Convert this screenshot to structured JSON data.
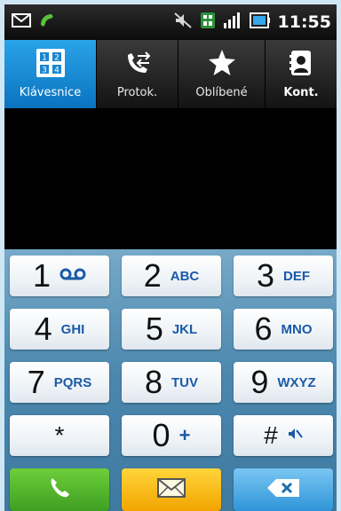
{
  "status_bar": {
    "time": "11:55",
    "icons": [
      "envelope-icon",
      "missed-call-icon",
      "mute-icon",
      "3g-icon",
      "signal-icon",
      "battery-icon"
    ]
  },
  "tabs": [
    {
      "label": "Klávesnice",
      "icon": "keypad-icon",
      "active": true
    },
    {
      "label": "Protok.",
      "icon": "call-log-icon",
      "active": false
    },
    {
      "label": "Oblíbené",
      "icon": "star-icon",
      "active": false
    },
    {
      "label": "Kont.",
      "icon": "contacts-icon",
      "active": false
    }
  ],
  "keys": [
    {
      "digit": "1",
      "letters": "oo",
      "icon": "voicemail-icon"
    },
    {
      "digit": "2",
      "letters": "ABC"
    },
    {
      "digit": "3",
      "letters": "DEF"
    },
    {
      "digit": "4",
      "letters": "GHI"
    },
    {
      "digit": "5",
      "letters": "JKL"
    },
    {
      "digit": "6",
      "letters": "MNO"
    },
    {
      "digit": "7",
      "letters": "PQRS"
    },
    {
      "digit": "8",
      "letters": "TUV"
    },
    {
      "digit": "9",
      "letters": "WXYZ"
    },
    {
      "digit": "*",
      "letters": ""
    },
    {
      "digit": "0",
      "letters": "+"
    },
    {
      "digit": "#",
      "letters": "",
      "icon": "mute-icon"
    }
  ],
  "actions": {
    "call": {
      "icon": "phone-icon"
    },
    "message": {
      "icon": "envelope-icon"
    },
    "delete": {
      "icon": "backspace-icon"
    }
  },
  "colors": {
    "tab_active": "#1e8fd8",
    "keypad_bg": "#4a86ad",
    "letters": "#1a5aa8",
    "call": "#4fb52c",
    "message": "#f5b800",
    "delete": "#3fa0df"
  }
}
